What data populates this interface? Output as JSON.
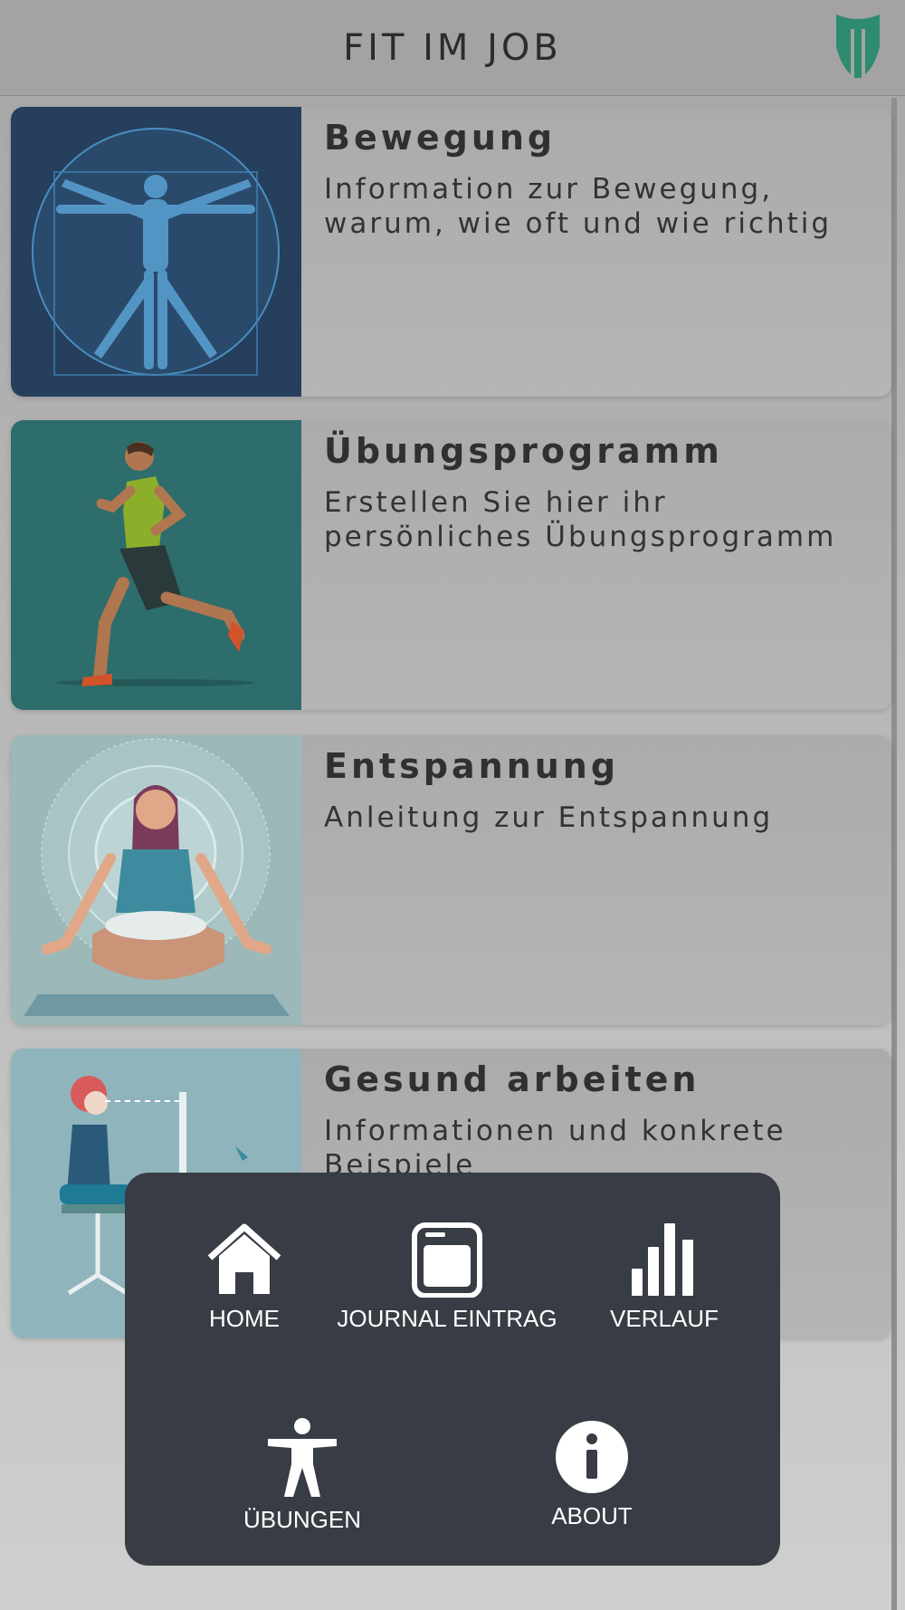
{
  "header": {
    "title": "FIT IM JOB",
    "logo_color": "#2e8b70"
  },
  "cards": [
    {
      "title": "Bewegung",
      "description": "Information zur Bewegung, warum, wie oft und wie richtig",
      "image": "vitruvian-man-illustration"
    },
    {
      "title": "Übungsprogramm",
      "description": "Erstellen Sie hier ihr persönliches Übungsprogramm",
      "image": "runner-illustration"
    },
    {
      "title": "Entspannung",
      "description": "Anleitung zur Entspannung",
      "image": "meditation-illustration"
    },
    {
      "title": "Gesund arbeiten",
      "description": "Informationen und konkrete Beispiele",
      "image": "ergonomic-desk-illustration"
    }
  ],
  "menu": {
    "background": "#383c44",
    "items": [
      {
        "label": "HOME",
        "icon": "home-icon"
      },
      {
        "label": "JOURNAL EINTRAG",
        "icon": "journal-icon"
      },
      {
        "label": "VERLAUF",
        "icon": "bar-chart-icon"
      },
      {
        "label": "ÜBUNGEN",
        "icon": "person-icon"
      },
      {
        "label": "ABOUT",
        "icon": "info-icon"
      }
    ]
  }
}
